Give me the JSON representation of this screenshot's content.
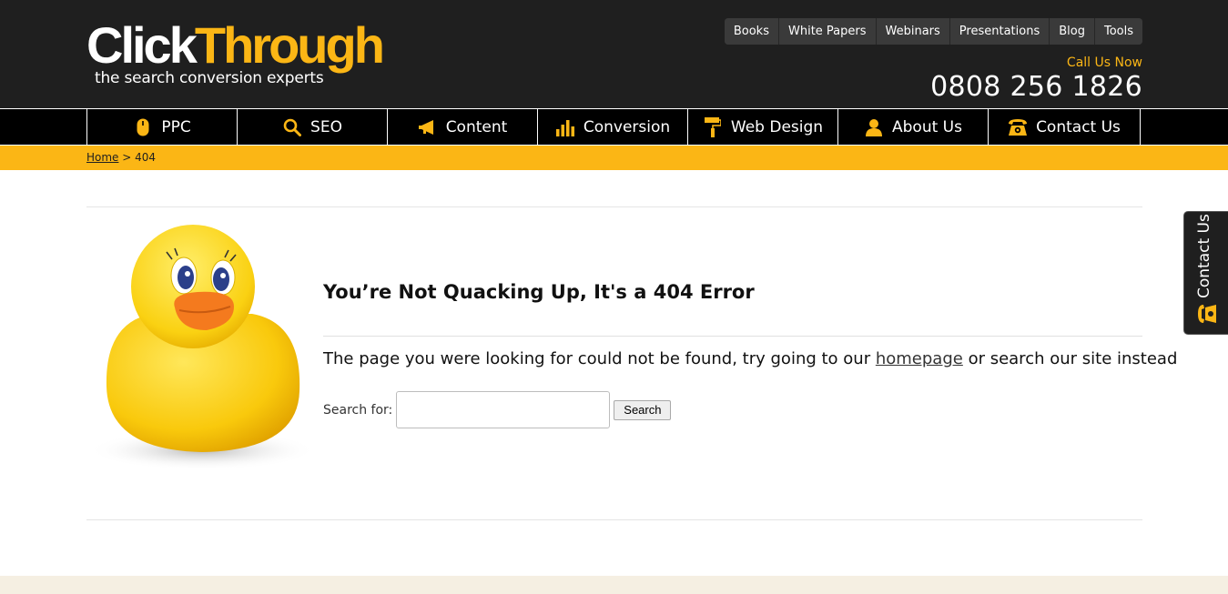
{
  "header": {
    "logo": {
      "part1": "Click",
      "part2": "Through",
      "tagline": "the search conversion experts"
    },
    "top_links": [
      "Books",
      "White Papers",
      "Webinars",
      "Presentations",
      "Blog",
      "Tools"
    ],
    "call_label": "Call Us Now",
    "phone": "0808 256 1826"
  },
  "nav": {
    "items": [
      {
        "label": "PPC",
        "icon": "mouse-icon"
      },
      {
        "label": "SEO",
        "icon": "magnifier-icon"
      },
      {
        "label": "Content",
        "icon": "megaphone-icon"
      },
      {
        "label": "Conversion",
        "icon": "bar-chart-icon"
      },
      {
        "label": "Web Design",
        "icon": "paint-roller-icon"
      },
      {
        "label": "About Us",
        "icon": "person-icon"
      },
      {
        "label": "Contact Us",
        "icon": "telephone-icon"
      }
    ]
  },
  "breadcrumb": {
    "home": "Home",
    "separator": " > ",
    "current": "404"
  },
  "main": {
    "title": "You’re Not Quacking Up, It's a 404 Error",
    "message_before": "The page you were looking for could not be found, try going to our ",
    "message_link": "homepage",
    "message_after": " or search our site instead",
    "search_label": "Search for:",
    "search_value": "",
    "search_button": "Search"
  },
  "side_tab": {
    "label": "Contact Us"
  },
  "colors": {
    "brand_yellow": "#fbb615",
    "header_bg": "#1f1f1f",
    "nav_bg": "#000000"
  }
}
